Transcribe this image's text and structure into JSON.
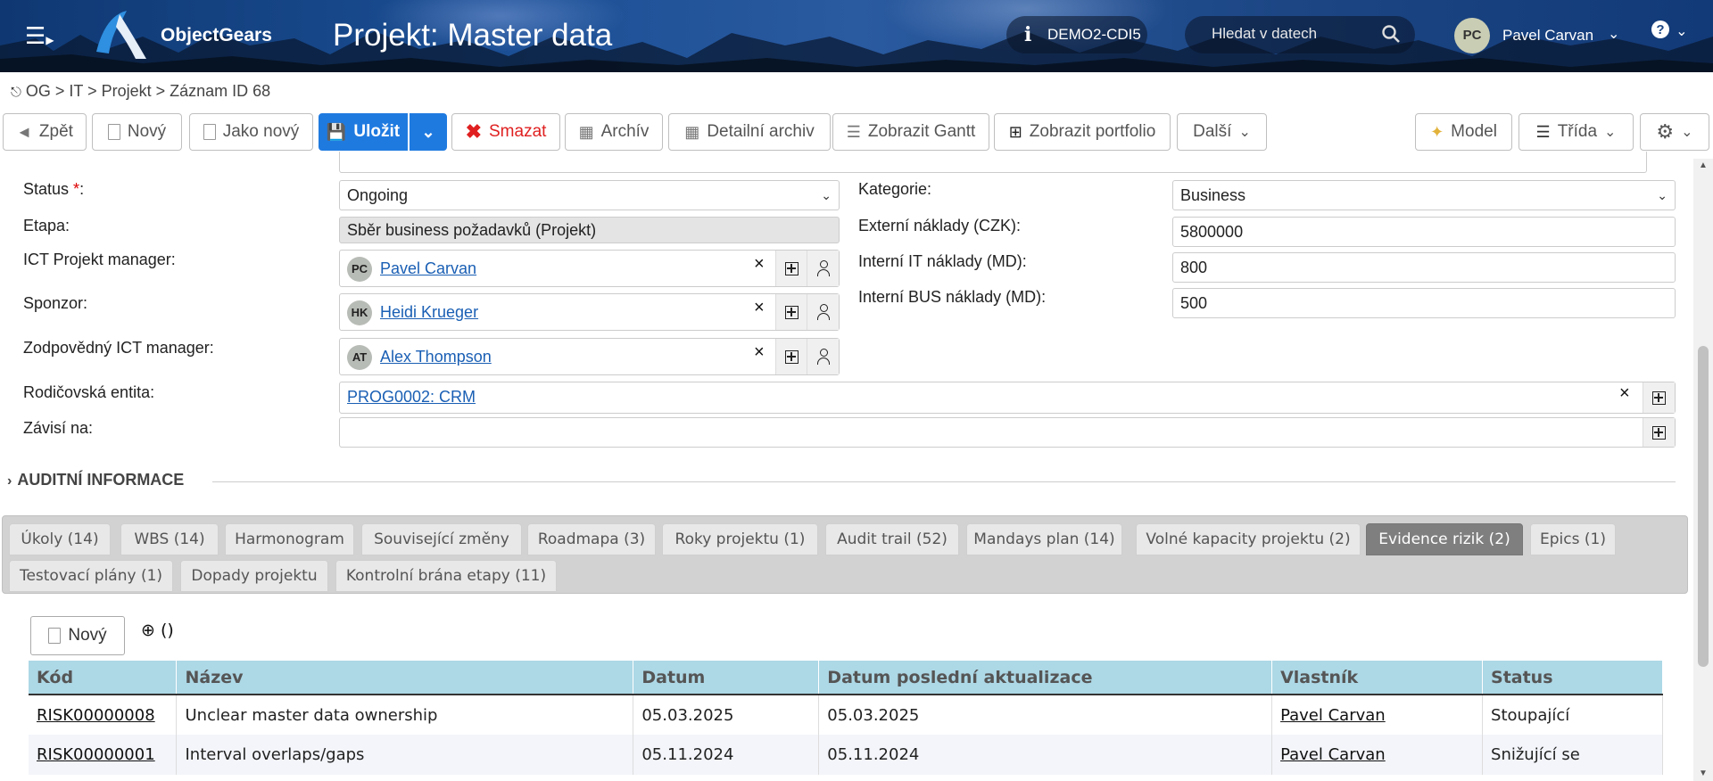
{
  "header": {
    "brand": "ObjectGears",
    "title": "Projekt: Master data",
    "environment": "DEMO2-CDI5",
    "search_placeholder": "Hledat v datech",
    "user_initials": "PC",
    "user_name": "Pavel Carvan"
  },
  "breadcrumb": "OG > IT > Projekt > Záznam ID 68",
  "toolbar": {
    "back": "Zpět",
    "new": "Nový",
    "as_new": "Jako nový",
    "save": "Uložit",
    "delete": "Smazat",
    "archive": "Archív",
    "detail_archive": "Detailní archiv",
    "gantt": "Zobrazit Gantt",
    "portfolio": "Zobrazit portfolio",
    "more": "Další",
    "model": "Model",
    "class": "Třída"
  },
  "form": {
    "status_label": "Status",
    "status_value": "Ongoing",
    "phase_label": "Etapa:",
    "phase_value": "Sběr business požadavků (Projekt)",
    "ict_pm_label": "ICT Projekt manager:",
    "ict_pm": {
      "initials": "PC",
      "name": "Pavel Carvan"
    },
    "sponsor_label": "Sponzor:",
    "sponsor": {
      "initials": "HK",
      "name": "Heidi Krueger"
    },
    "resp_label": "Zodpovědný ICT manager:",
    "resp": {
      "initials": "AT",
      "name": "Alex Thompson"
    },
    "parent_label": "Rodičovská entita:",
    "parent_value": "PROG0002: CRM",
    "depends_label": "Závisí na:",
    "category_label": "Kategorie:",
    "category_value": "Business",
    "ext_cost_label": "Externí náklady (CZK):",
    "ext_cost_value": "5800000",
    "int_it_label": "Interní IT náklady (MD):",
    "int_it_value": "800",
    "int_bus_label": "Interní BUS náklady (MD):",
    "int_bus_value": "500"
  },
  "section": {
    "audit": "AUDITNÍ INFORMACE"
  },
  "tabs": [
    "Úkoly (14)",
    "WBS (14)",
    "Harmonogram",
    "Související změny",
    "Roadmapa (3)",
    "Roky projektu (1)",
    "Audit trail (52)",
    "Mandays plan (14)",
    "Volné kapacity projektu (2)",
    "Evidence rizik (2)",
    "Epics (1)",
    "Testovací plány (1)",
    "Dopady projektu",
    "Kontrolní brána etapy (11)"
  ],
  "risk_panel": {
    "new_button": "Nový",
    "count_text": "()",
    "columns": [
      "Kód",
      "Název",
      "Datum",
      "Datum poslední aktualizace",
      "Vlastník",
      "Status"
    ],
    "rows": [
      [
        "RISK00000008",
        "Unclear master data ownership",
        "05.03.2025",
        "05.03.2025",
        "Pavel Carvan",
        "Stoupající"
      ],
      [
        "RISK00000001",
        "Interval overlaps/gaps",
        "05.11.2024",
        "05.11.2024",
        "Pavel Carvan",
        "Snižující se"
      ]
    ]
  },
  "colors": {
    "primary": "#1f7ae0",
    "danger": "#e02020",
    "active_tab": "#7f7f7f",
    "grid_header": "#add8e6"
  }
}
